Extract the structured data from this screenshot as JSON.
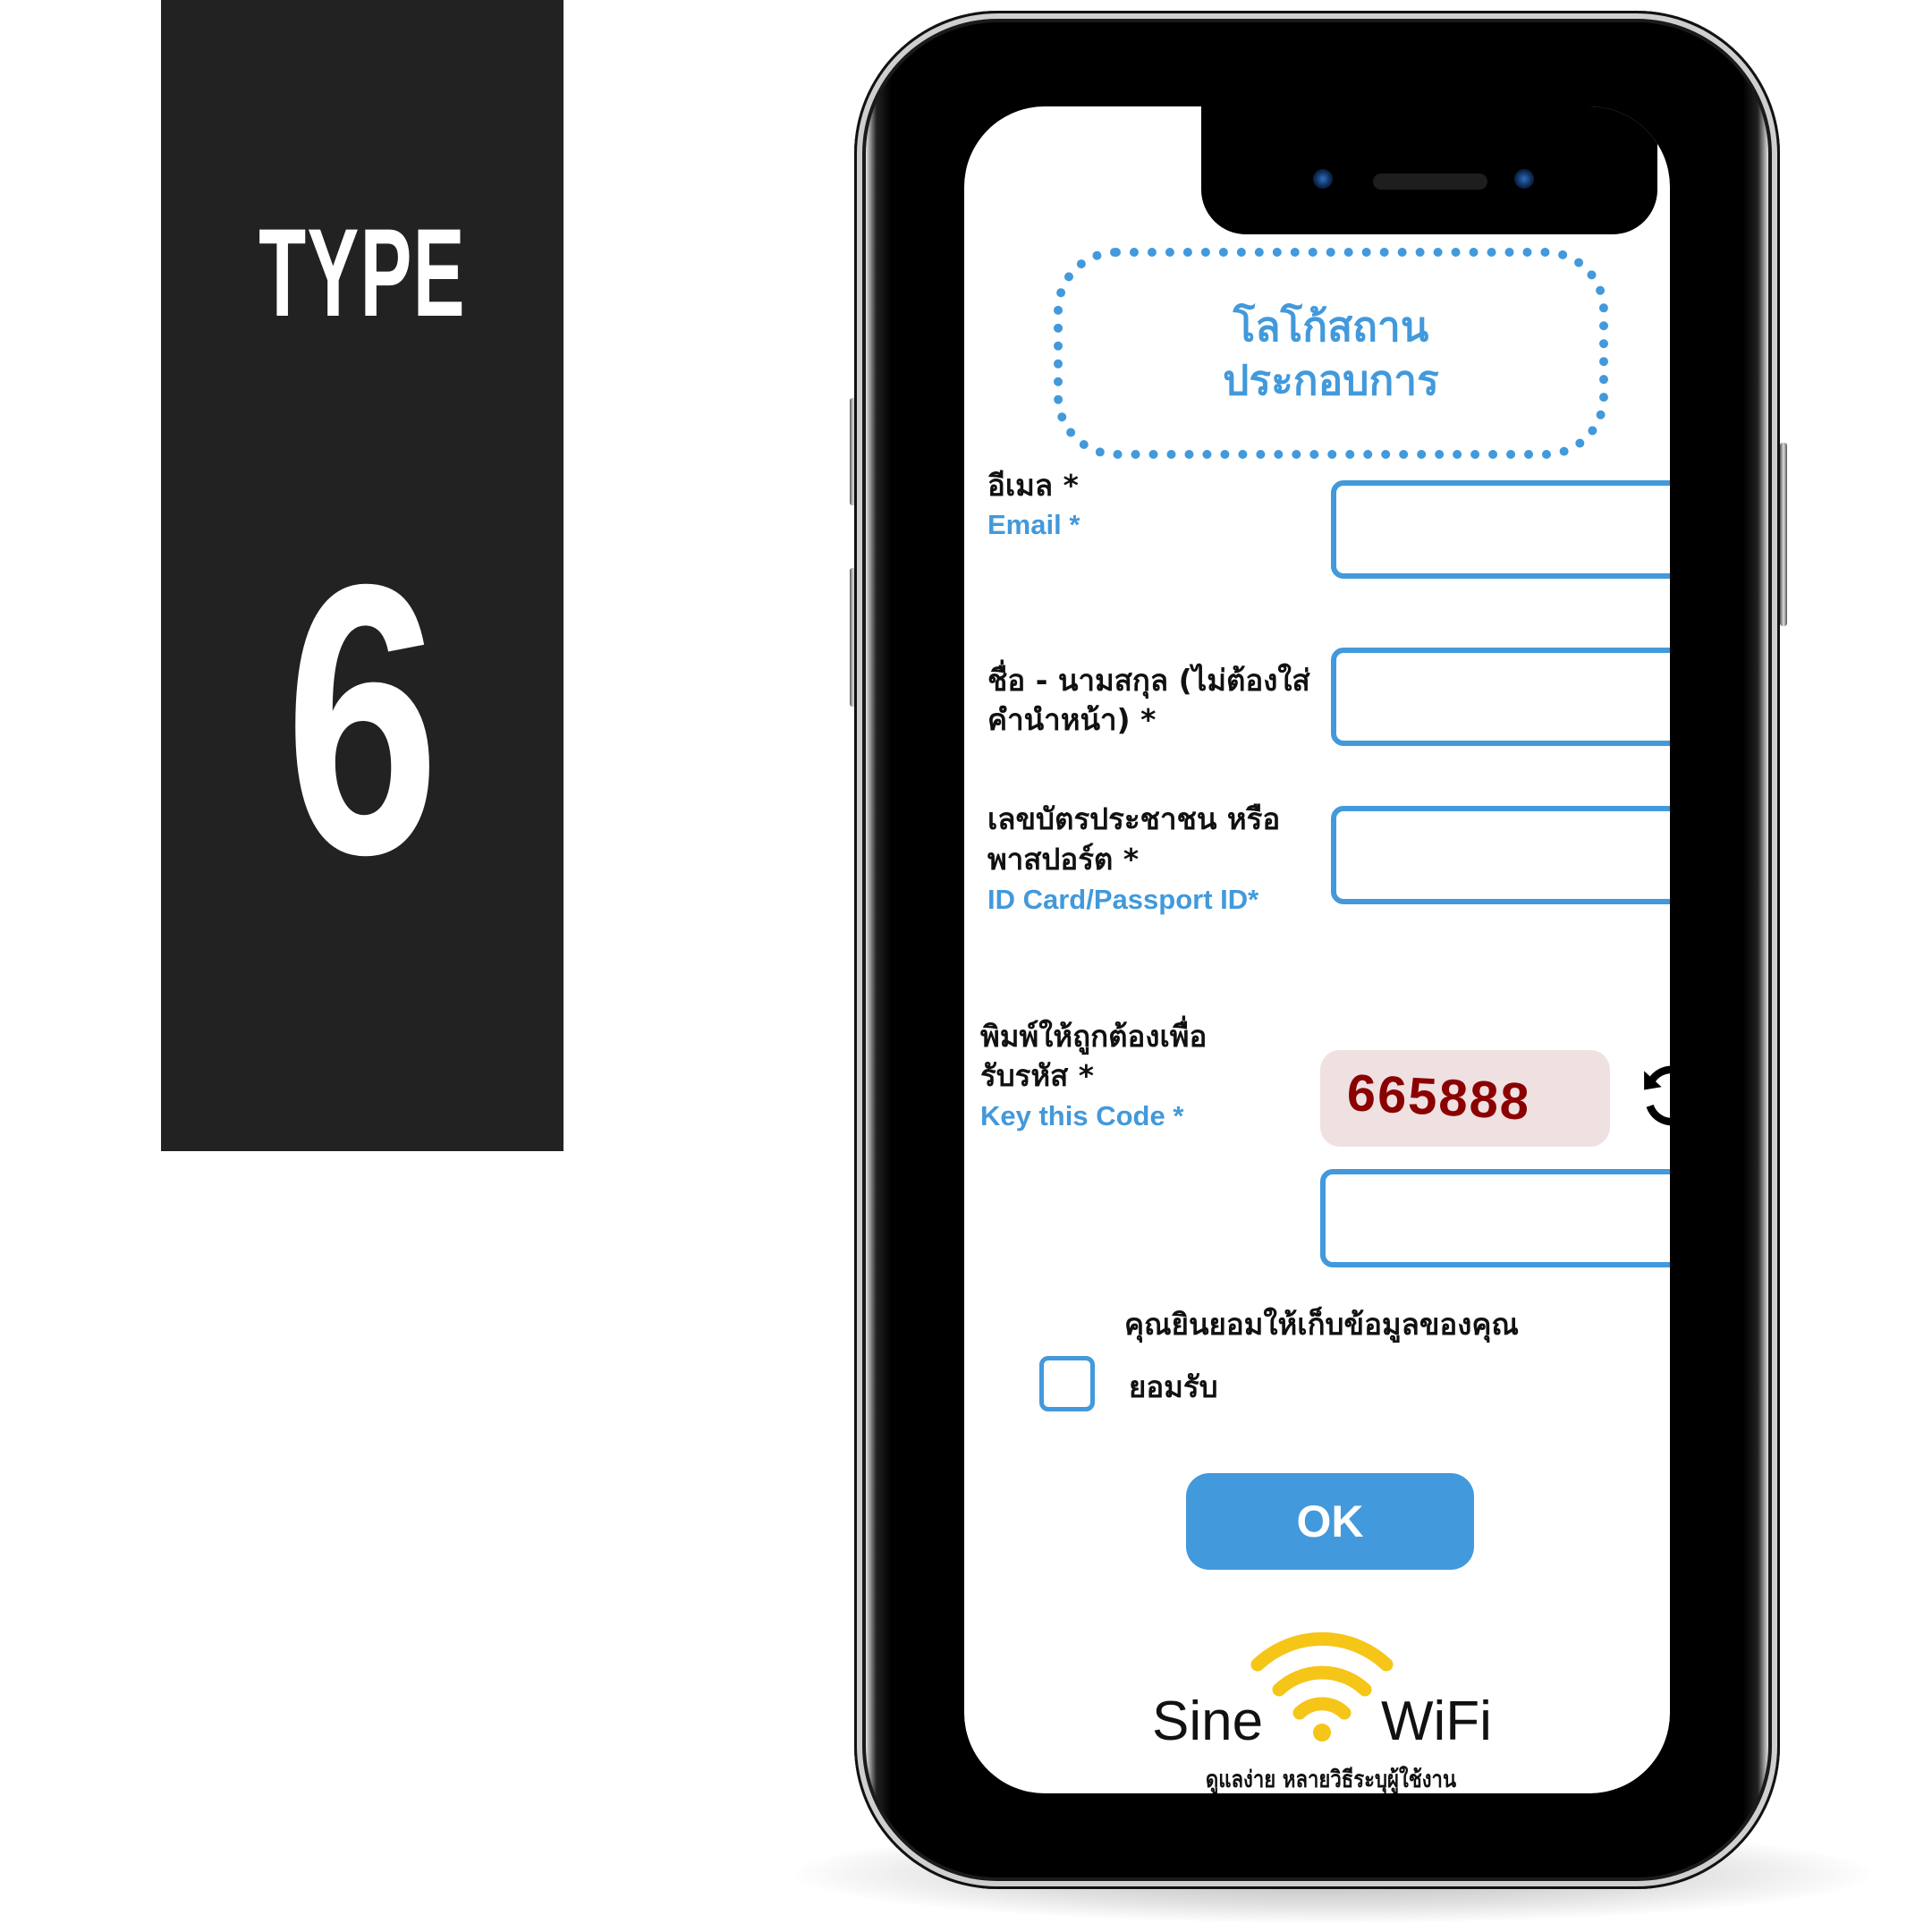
{
  "panel": {
    "type_label": "TYPE",
    "type_number": "6"
  },
  "login_form": {
    "logo_placeholder": {
      "line1": "โลโก้สถาน",
      "line2": "ประกอบการ"
    },
    "fields": {
      "email": {
        "label_th": "อีเมล *",
        "label_en": "Email *",
        "value": ""
      },
      "fullname": {
        "label_th_line1": "ชื่อ - นามสกุล (ไม่ต้องใส่",
        "label_th_line2": "คำนำหน้า) *",
        "value": ""
      },
      "id_card": {
        "label_th_line1": "เลขบัตรประชาชน หรือ",
        "label_th_line2": "พาสปอร์ต *",
        "label_en": "ID Card/Passport ID*",
        "value": ""
      },
      "captcha": {
        "label_th_line1": "พิมพ์ให้ถูกต้องเพื่อ",
        "label_th_line2": "รับรหัส *",
        "label_en": "Key this Code *",
        "code": "665888",
        "refresh_icon": "refresh-icon",
        "value": ""
      }
    },
    "consent": {
      "question": "คุณยินยอมให้เก็บข้อมูลของคุณ",
      "checkbox_label": "ยอมรับ",
      "checked": false
    },
    "submit_label": "OK",
    "brand": {
      "name_left": "Sine",
      "name_right": "WiFi",
      "icon": "wifi-icon",
      "tagline": "ดูแลง่าย หลายวิธีระบุผู้ใช้งาน"
    }
  },
  "colors": {
    "accent": "#4299db",
    "panel_bg": "#222222",
    "captcha_bg": "#efe1e2",
    "captcha_text": "#8b0000",
    "wifi_yellow": "#f5c518"
  }
}
